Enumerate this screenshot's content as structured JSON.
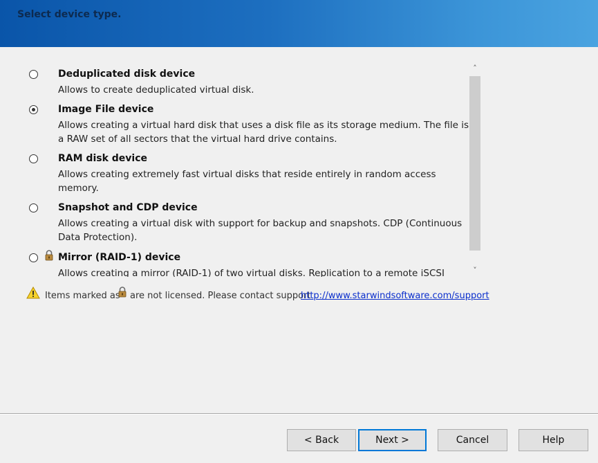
{
  "header": {
    "title": "Select device type."
  },
  "options": [
    {
      "title": "Deduplicated disk device",
      "description": "Allows to create deduplicated virtual disk.",
      "checked": false,
      "locked": false
    },
    {
      "title": "Image File device",
      "description": "Allows creating a virtual hard disk that uses a disk file as its storage medium. The file is a RAW set of all sectors that the virtual hard drive contains.",
      "checked": true,
      "locked": false
    },
    {
      "title": "RAM disk device",
      "description": "Allows creating extremely fast virtual disks that reside entirely in random access memory.",
      "checked": false,
      "locked": false
    },
    {
      "title": "Snapshot and CDP device",
      "description": "Allows creating a virtual disk with support for backup and snapshots. CDP (Continuous Data Protection).",
      "checked": false,
      "locked": false
    },
    {
      "title": "Mirror (RAID-1) device",
      "description": "Allows creating a mirror (RAID-1) of two virtual disks. Replication to a remote iSCSI",
      "checked": false,
      "locked": true
    }
  ],
  "notice": {
    "text_before": "Items marked as",
    "text_after": "are not licensed. Please contact support",
    "link": "http://www.starwindsoftware.com/support"
  },
  "buttons": {
    "back": "< Back",
    "next": "Next >",
    "cancel": "Cancel",
    "help": "Help"
  },
  "icons": {
    "warning": "warning-icon",
    "lock": "lock-icon",
    "scroll_up": "chevron-up-icon",
    "scroll_down": "chevron-down-icon"
  },
  "colors": {
    "header_start": "#0a55a9",
    "header_end": "#4aa3e0",
    "link": "#0a2ecc",
    "default_button_border": "#0078d7"
  }
}
